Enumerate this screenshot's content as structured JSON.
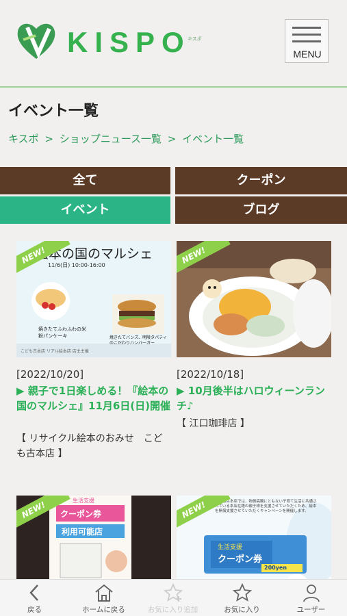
{
  "header": {
    "logo_text": "KISPO",
    "logo_sub": "キスポ",
    "menu_label": "MENU"
  },
  "page": {
    "title": "イベント一覧",
    "breadcrumb": [
      "キスポ",
      ">",
      "ショップニュース一覧",
      ">",
      "イベント一覧"
    ]
  },
  "tabs": [
    {
      "label": "全て",
      "active": false
    },
    {
      "label": "クーポン",
      "active": false
    },
    {
      "label": "イベント",
      "active": true
    },
    {
      "label": "ブログ",
      "active": false
    }
  ],
  "cards": [
    {
      "badge": "NEW!",
      "date": "[2022/10/20]",
      "title": "▶ 親子で1日楽しめる！『絵本の国のマルシェ』11月6日(日)開催",
      "shop": "【 リサイクル絵本のおみせ　こども古本店 】",
      "thumb": {
        "heading": "絵本の国のマルシェ",
        "subline": "11/6(日)  10:00-16:00",
        "caption_left": "焼きたてふわふわの米粉パンケーキ",
        "caption_right": "焼きたてバンズ、明陵タパティのこだわりハンバーガー",
        "footer": "こども古本店 リアル絵本店 店主主催"
      }
    },
    {
      "badge": "NEW!",
      "date": "[2022/10/18]",
      "title": "▶ 10月後半はハロウィーンランチ♪",
      "shop": "【 江口珈琲店 】"
    },
    {
      "badge": "NEW!",
      "thumb": {
        "line1": "生活支援",
        "line2": "クーポン券",
        "line3": "利用可能店"
      }
    },
    {
      "badge": "NEW!",
      "thumb": {
        "lead": "こども古本店では、物価高騰にともない子育て生活に共通されている本店在籍の親子様を支援させていただくため、絵本を無償支援させていただくキャンペーンを開催します。",
        "line1": "生活支援",
        "line2": "クーポン券",
        "amount": "200yen"
      }
    }
  ],
  "bottom_nav": [
    {
      "label": "戻る",
      "icon": "back-chevron-icon",
      "disabled": false
    },
    {
      "label": "ホームに戻る",
      "icon": "home-icon",
      "disabled": false
    },
    {
      "label": "お気に入り追加",
      "icon": "star-plus-icon",
      "disabled": true
    },
    {
      "label": "お気に入り",
      "icon": "star-icon",
      "disabled": false
    },
    {
      "label": "ユーザー",
      "icon": "user-icon",
      "disabled": false
    }
  ],
  "colors": {
    "brand_green": "#35b24e",
    "tab_brown": "#5b3a26",
    "tab_active": "#2bb486",
    "link_green": "#2bb057"
  }
}
